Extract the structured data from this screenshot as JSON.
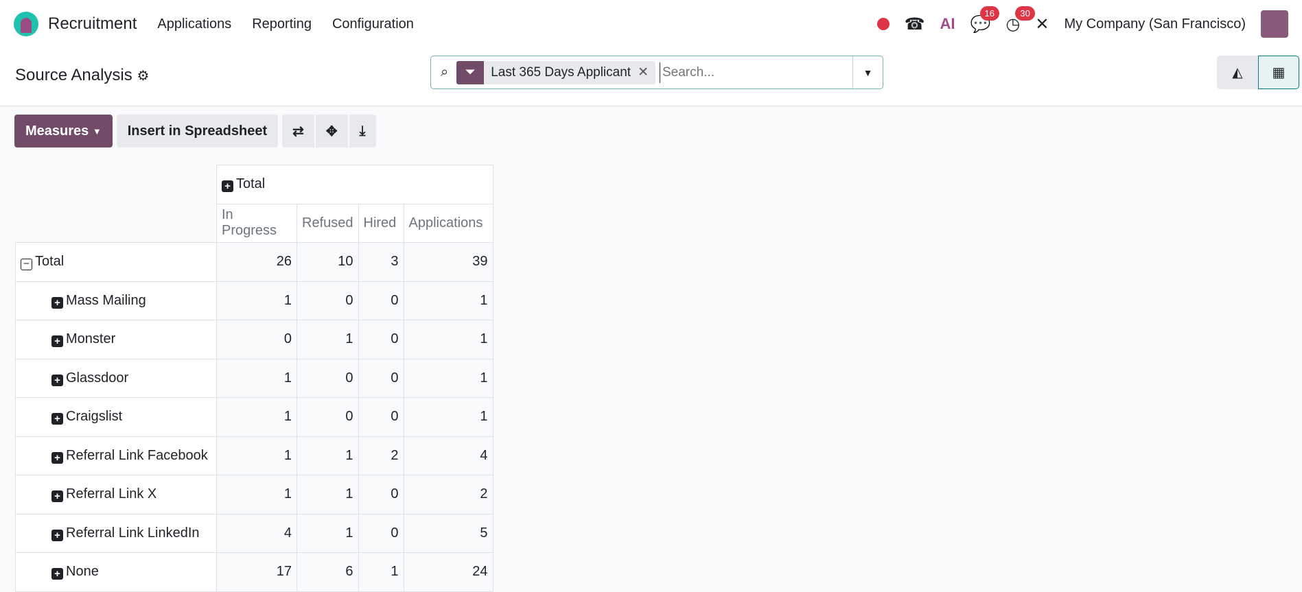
{
  "nav": {
    "app": "Recruitment",
    "menu": [
      "Applications",
      "Reporting",
      "Configuration"
    ],
    "chat_badge": "16",
    "activity_badge": "30",
    "ai": "AI",
    "company": "My Company (San Francisco)"
  },
  "cp": {
    "title": "Source Analysis",
    "facet": "Last 365 Days Applicant",
    "search_placeholder": "Search..."
  },
  "toolbar": {
    "measures": "Measures",
    "insert": "Insert in Spreadsheet"
  },
  "pivot": {
    "col_group": "Total",
    "columns": [
      "In Progress",
      "Refused",
      "Hired",
      "Applications"
    ],
    "total": {
      "label": "Total",
      "values": [
        26,
        10,
        3,
        39
      ]
    },
    "rows": [
      {
        "label": "Mass Mailing",
        "values": [
          1,
          0,
          0,
          1
        ]
      },
      {
        "label": "Monster",
        "values": [
          0,
          1,
          0,
          1
        ]
      },
      {
        "label": "Glassdoor",
        "values": [
          1,
          0,
          0,
          1
        ]
      },
      {
        "label": "Craigslist",
        "values": [
          1,
          0,
          0,
          1
        ]
      },
      {
        "label": "Referral Link Facebook",
        "values": [
          1,
          1,
          2,
          4
        ]
      },
      {
        "label": "Referral Link X",
        "values": [
          1,
          1,
          0,
          2
        ]
      },
      {
        "label": "Referral Link LinkedIn",
        "values": [
          4,
          1,
          0,
          5
        ]
      },
      {
        "label": "None",
        "values": [
          17,
          6,
          1,
          24
        ]
      }
    ]
  }
}
